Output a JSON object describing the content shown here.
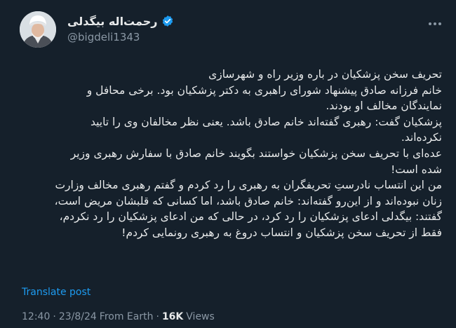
{
  "author": {
    "display_name": "رحمت‌اله بیگدلی",
    "handle": "@bigdeli1343",
    "verified_icon": "verified-badge-icon",
    "accent_color": "#1d9bf0"
  },
  "post": {
    "lines": [
      "تحریف سخن پزشکیان در باره وزیر راه و شهرسازی",
      "خانم فرزانه صادق پیشنهاد شورای راهبری به دکتر پزشکیان بود. برخی محافل و",
      "نمایندگان مخالف او بودند.",
      "پزشکیان گفت: رهبری گفته‌اند خانم صادق باشد. یعنی نظر مخالفان وی را تایید",
      "نکرده‌اند.",
      "عده‌ای با تحریف سخن پزشکیان خواستند بگویند خانم صادق با سفارش رهبری وزیر",
      "شده است!",
      "من این انتساب نادرستِ تحریفگران به رهبری را رد کردم و گفتم رهبری مخالف وزارت",
      "زنان نبوده‌اند و از این‌رو گفته‌اند: خانم صادق باشد، اما کسانی که قلبشان مریض است،",
      "گفتند: بیگدلی ادعای پزشکیان را رد کرد، در حالی که من ادعای پزشکیان را رد نکردم،",
      "فقط از تحریف سخن پزشکیان و انتساب دروغ به رهبری رونمایی کردم!"
    ],
    "translate_label": "Translate post",
    "time": "12:40",
    "separator": "·",
    "date": "23/8/24",
    "source": "From Earth",
    "views_count": "16K",
    "views_label": "Views"
  }
}
